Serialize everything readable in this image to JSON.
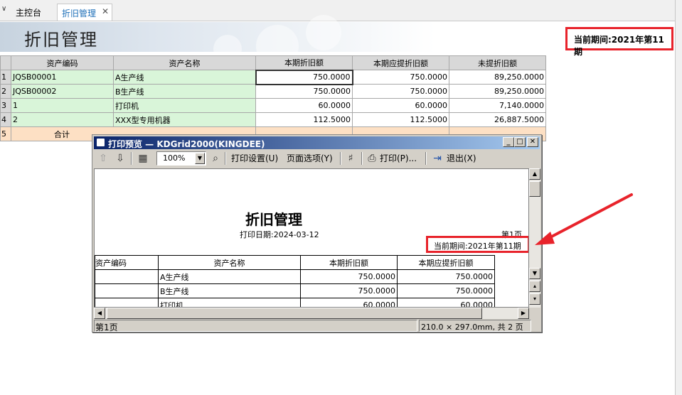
{
  "tabs": [
    {
      "label": "主控台"
    },
    {
      "label": "折旧管理"
    }
  ],
  "page": {
    "title": "折旧管理",
    "period": "当前期间:2021年第11期"
  },
  "grid": {
    "columns": [
      "资产编码",
      "资产名称",
      "本期折旧额",
      "本期应提折旧额",
      "未提折旧额"
    ],
    "rows": [
      {
        "no": "1",
        "code": "JQSB00001",
        "name": "A生产线",
        "dep": "750.0000",
        "should": "750.0000",
        "remain": "89,250.0000"
      },
      {
        "no": "2",
        "code": "JQSB00002",
        "name": "B生产线",
        "dep": "750.0000",
        "should": "750.0000",
        "remain": "89,250.0000"
      },
      {
        "no": "3",
        "code": "1",
        "name": "打印机",
        "dep": "60.0000",
        "should": "60.0000",
        "remain": "7,140.0000"
      },
      {
        "no": "4",
        "code": "2",
        "name": "XXX型专用机器",
        "dep": "112.5000",
        "should": "112.5000",
        "remain": "26,887.5000"
      }
    ],
    "sum_row": {
      "no": "5",
      "label": "合计"
    }
  },
  "dialog": {
    "title": "打印预览 — KDGrid2000(KINGDEE)",
    "zoom": "100%",
    "print_settings": "打印设置(U)",
    "page_options": "页面选项(Y)",
    "print": "打印(P)...",
    "exit": "退出(X)",
    "status_page": "第1页",
    "status_size": "210.0 × 297.0mm, 共 2 页"
  },
  "preview": {
    "title": "折旧管理",
    "print_date": "打印日期:2024-03-12",
    "page_no": "第1页",
    "period": "当前期间:2021年第11期",
    "columns": [
      "资产编码",
      "资产名称",
      "本期折旧额",
      "本期应提折旧额"
    ],
    "rows": [
      {
        "name": "A生产线",
        "dep": "750.0000",
        "should": "750.0000"
      },
      {
        "name": "B生产线",
        "dep": "750.0000",
        "should": "750.0000"
      },
      {
        "name": "打印机",
        "dep": "60.0000",
        "should": "60.0000"
      }
    ]
  },
  "colors": {
    "highlight": "#e8232b",
    "row_green": "#d9f5d9",
    "sum_row": "#fde0c4",
    "title_bar": "#0a246a"
  }
}
